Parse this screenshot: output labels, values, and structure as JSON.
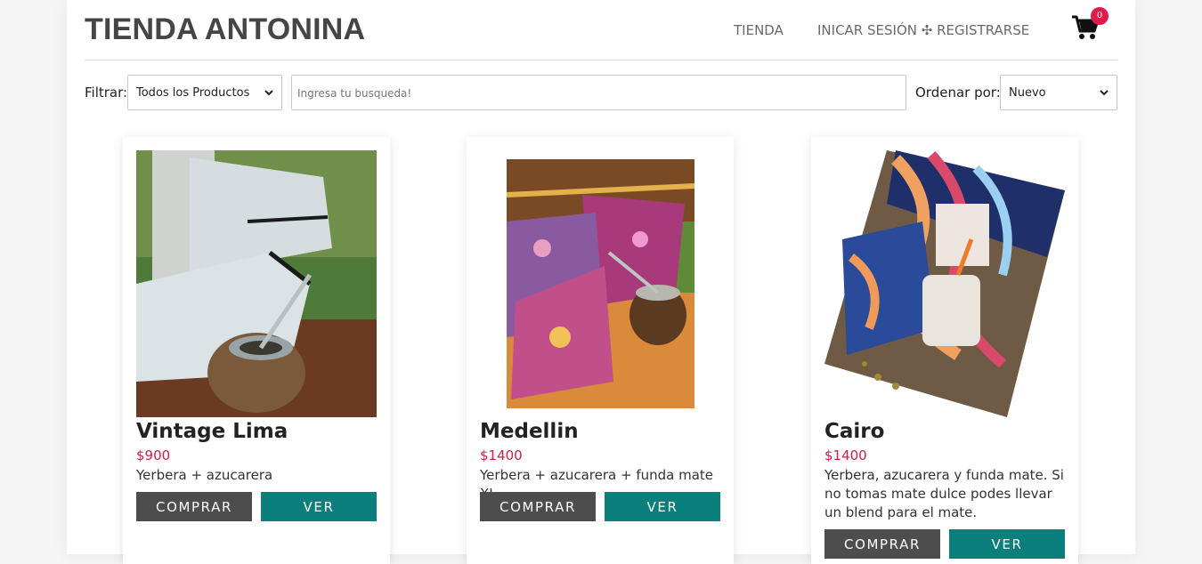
{
  "header": {
    "brand": "TIENDA ANTONINA",
    "nav_shop": "TIENDA",
    "nav_login": "INICAR SESIÓN ✣ REGISTRARSE",
    "cart_count": "0"
  },
  "filters": {
    "filter_label": "Filtrar:",
    "filter_selected": "Todos los Productos",
    "search_placeholder": "Ingresa tu busqueda!",
    "sort_label": "Ordenar por:",
    "sort_selected": "Nuevo"
  },
  "products": [
    {
      "name": "Vintage Lima",
      "price": "$900",
      "description": "Yerbera + azucarera",
      "buy_label": "COMPRAR",
      "view_label": "VER"
    },
    {
      "name": "Medellin",
      "price": "$1400",
      "description": "Yerbera + azucarera + funda mate XL",
      "buy_label": "COMPRAR",
      "view_label": "VER"
    },
    {
      "name": "Cairo",
      "price": "$1400",
      "description": "Yerbera, azucarera y funda mate. Si no tomas mate dulce podes llevar un blend para el mate.",
      "buy_label": "COMPRAR",
      "view_label": "VER"
    }
  ],
  "colors": {
    "price": "#d41b44",
    "buy_button": "#4d4d4d",
    "view_button": "#0a7f7b",
    "badge": "#e01a4a"
  }
}
